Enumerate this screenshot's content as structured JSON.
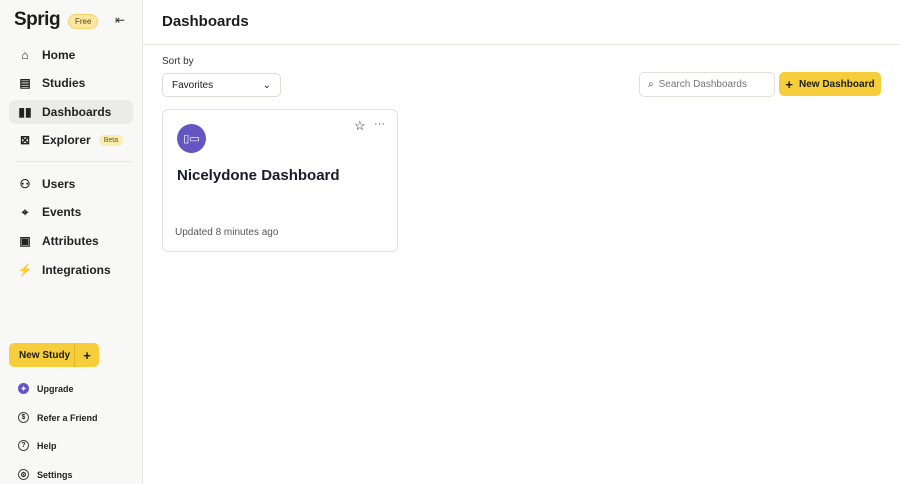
{
  "sidebar": {
    "logo": "Sprig",
    "plan_badge": "Free",
    "items": [
      {
        "label": "Home"
      },
      {
        "label": "Studies"
      },
      {
        "label": "Dashboards"
      },
      {
        "label": "Explorer",
        "badge": "Beta"
      },
      {
        "label": "Users"
      },
      {
        "label": "Events"
      },
      {
        "label": "Attributes"
      },
      {
        "label": "Integrations"
      }
    ],
    "new_study": "New Study",
    "footer": [
      {
        "label": "Upgrade"
      },
      {
        "label": "Refer a Friend"
      },
      {
        "label": "Help"
      },
      {
        "label": "Settings"
      }
    ]
  },
  "header": {
    "title": "Dashboards"
  },
  "toolbar": {
    "sort_label": "Sort by",
    "sort_value": "Favorites",
    "search_placeholder": "Search Dashboards",
    "new_dashboard": "New Dashboard"
  },
  "dashboards": [
    {
      "name": "Nicelydone Dashboard",
      "updated": "Updated 8 minutes ago"
    }
  ],
  "colors": {
    "accent": "#f6cd3a",
    "icon_bg": "#6555c2"
  }
}
